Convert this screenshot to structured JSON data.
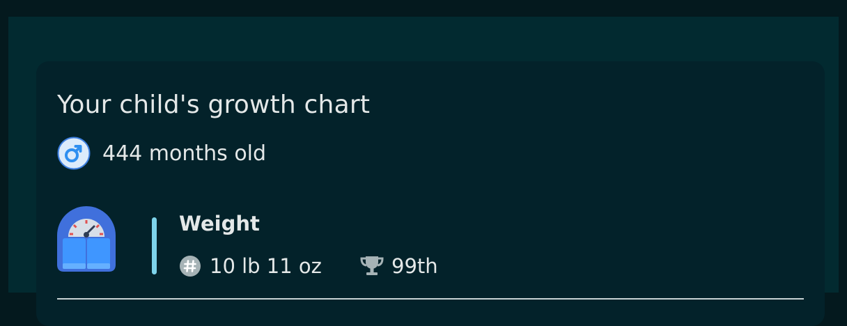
{
  "card": {
    "title": "Your child's growth chart",
    "age": "444 months old",
    "gender_icon": "male-symbol-icon"
  },
  "metric": {
    "label": "Weight",
    "icon": "baby-scale-icon",
    "value": "10 lb 11 oz",
    "value_icon": "hash-icon",
    "percentile": "99th",
    "percentile_icon": "trophy-icon",
    "accent_color": "#7dd3ea"
  },
  "colors": {
    "background": "#04191e",
    "panel": "#022a30",
    "card": "#03222a",
    "text": "#e4e8e8",
    "icon_blue": "#2f8ff0"
  }
}
